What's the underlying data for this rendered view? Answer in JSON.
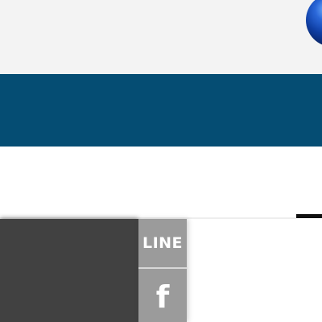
{
  "header": {
    "logo_icon": "globe-icon"
  },
  "social": {
    "line_label": "LINE",
    "facebook_label": "f",
    "facebook_icon": "facebook-icon"
  },
  "colors": {
    "header_bg": "#f3f3f3",
    "banner": "#054d73",
    "drawer": "#414141",
    "share_button": "#9b9b9b",
    "accent_bar": "#111111"
  }
}
